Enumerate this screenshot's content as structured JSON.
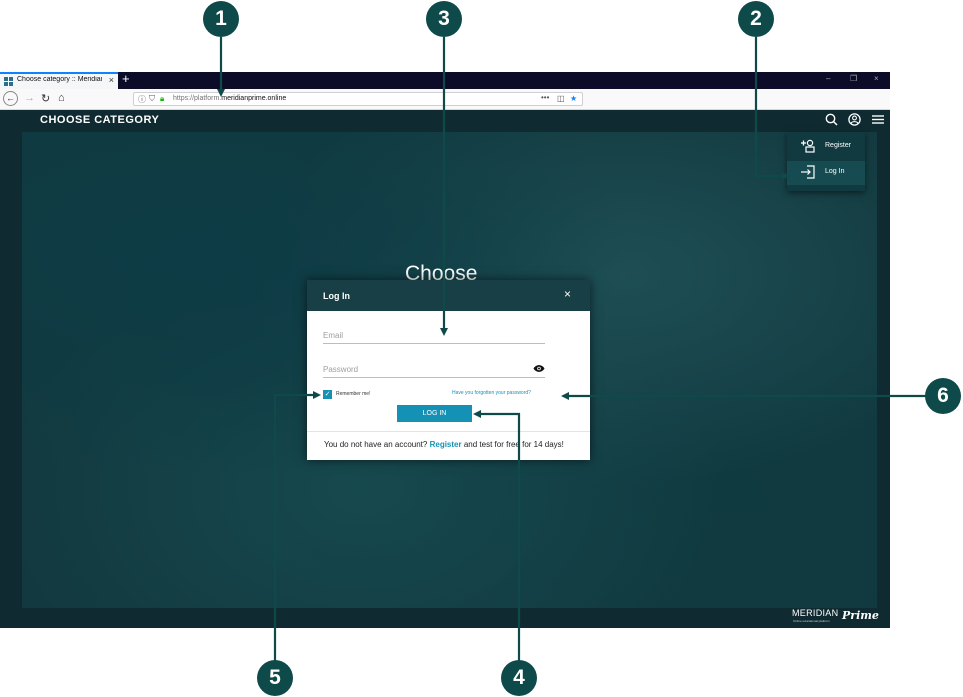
{
  "browser": {
    "tab_title": "Choose category :: Meridian Pr",
    "tab_close": "×",
    "new_tab": "+",
    "window_controls": [
      "–",
      "❐",
      "×"
    ],
    "url_prefix": "https://platform.",
    "url_domain": "meridianprime.online",
    "url_more": "•••"
  },
  "header": {
    "title": "CHOOSE CATEGORY",
    "icons": [
      "search-icon",
      "user-icon",
      "menu-icon"
    ]
  },
  "user_menu": {
    "items": [
      {
        "label": "Register",
        "icon": "add-user-icon"
      },
      {
        "label": "Log In",
        "icon": "login-icon"
      }
    ]
  },
  "background": {
    "heading": "Choose"
  },
  "login_modal": {
    "title": "Log In",
    "close": "×",
    "email_placeholder": "Email",
    "password_placeholder": "Password",
    "remember_checked": true,
    "remember_label": "Remember me!",
    "forgot_link": "Have you forgotten your password?",
    "login_button": "LOG IN",
    "footer_prefix": "You do not have an account?",
    "footer_link": "Register",
    "footer_suffix": "and test for free for 14 days!"
  },
  "logo": {
    "name": "MERIDIAN",
    "suffix": "Prime",
    "tagline": "Online educational platform"
  },
  "callouts": [
    "1",
    "2",
    "3",
    "4",
    "5",
    "6"
  ],
  "colors": {
    "accent": "#1591b6",
    "callout": "#0e4a4a",
    "modal_header": "#183f45",
    "page_bg": "#0f2b31"
  }
}
